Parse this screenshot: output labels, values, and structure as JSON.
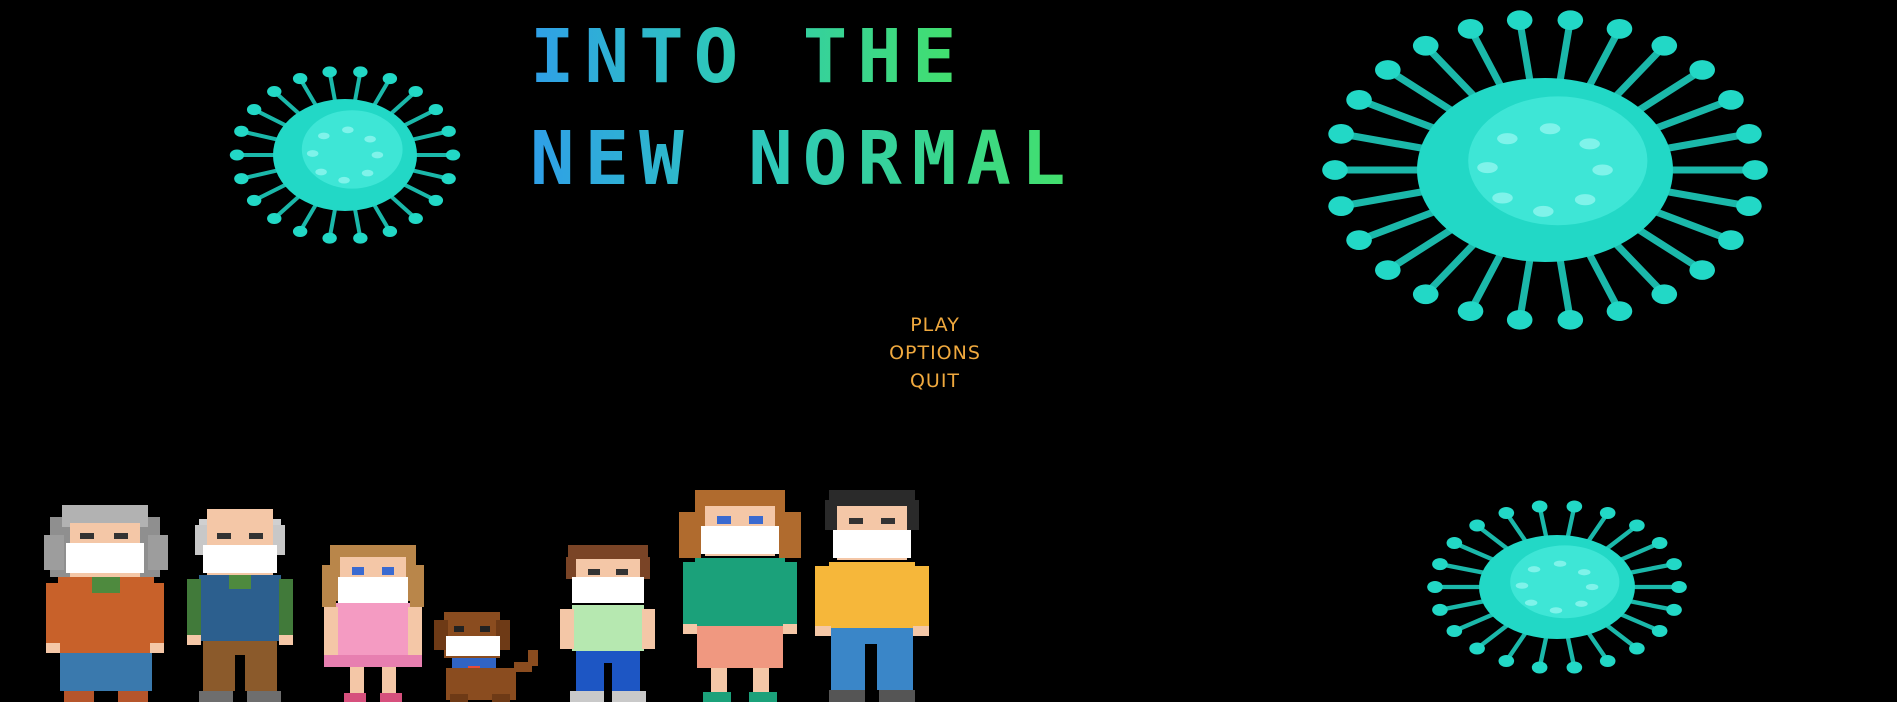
{
  "game": {
    "title_line1": "INTO THE",
    "title_line2": "NEW NORMAL"
  },
  "menu": {
    "play": "PLAY",
    "options": "OPTIONS",
    "quit": "QUIT"
  },
  "colors": {
    "background": "#000000",
    "menu_text": "#f0a93e",
    "title_blue": "#2f9fe8",
    "title_green": "#43e06a",
    "virus": "#22d8c6"
  },
  "sprites": [
    "grandmother",
    "grandfather",
    "girl",
    "dog",
    "boy",
    "mother",
    "father"
  ]
}
